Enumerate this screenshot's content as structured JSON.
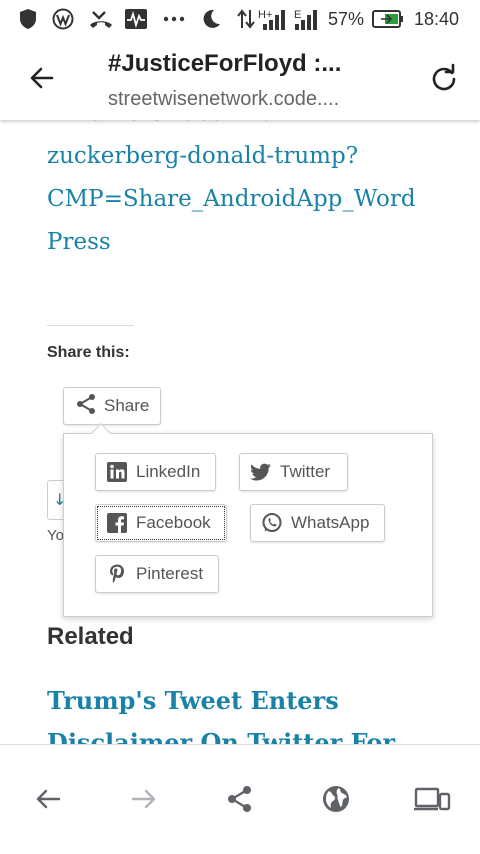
{
  "status_bar": {
    "signal_1": "H+",
    "signal_2": "E",
    "battery_percent": "57%",
    "time": "18:40"
  },
  "app_bar": {
    "title": "#JusticeForFloyd :...",
    "url": "streetwisenetwork.code...."
  },
  "article": {
    "link_lines": [
      "k-workers-rebel-mark-",
      "zuckerberg-donald-trump?",
      "CMP=Share_AndroidApp_Word",
      "Press"
    ]
  },
  "share": {
    "heading": "Share this:",
    "button_label": "Share",
    "behind_button_glyph": "↓",
    "behind_text": "Yo",
    "options": {
      "linkedin": "LinkedIn",
      "twitter": "Twitter",
      "facebook": "Facebook",
      "whatsapp": "WhatsApp",
      "pinterest": "Pinterest"
    }
  },
  "related": {
    "heading": "Related",
    "link_lines": [
      "Trump's Tweet Enters",
      "Disclaimer On Twitter For"
    ]
  },
  "colors": {
    "link": "#1a82a6",
    "text": "#333333",
    "border": "#cccccc",
    "icon": "#5f6368",
    "battery_fill": "#2e9e3b"
  },
  "icons": {
    "status": [
      "shield-icon",
      "wordpress-icon",
      "missed-call-icon",
      "activity-icon",
      "more-dots-icon",
      "moon-icon",
      "data-transfer-icon",
      "signal-icon",
      "battery-icon"
    ],
    "app_bar": [
      "back-arrow-icon",
      "reload-icon"
    ],
    "bottom": [
      "back-icon",
      "forward-icon",
      "share-icon",
      "globe-icon",
      "devices-icon"
    ]
  }
}
